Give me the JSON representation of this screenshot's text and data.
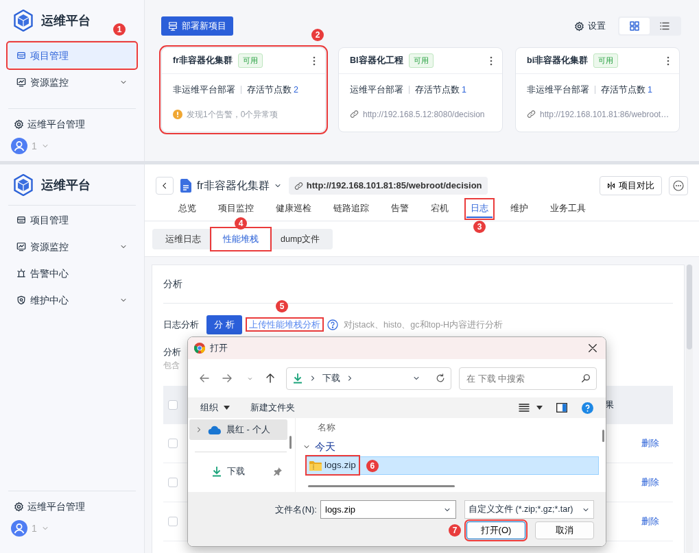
{
  "top_screen": {
    "sidebar": {
      "brand": "运维平台",
      "items": [
        {
          "label": "项目管理",
          "kind": "list",
          "selected": true,
          "expandable": false,
          "step": "1"
        },
        {
          "label": "资源监控",
          "kind": "chart",
          "selected": false,
          "expandable": true
        }
      ],
      "footer": "运维平台管理",
      "user": "1"
    },
    "deploy_button": "部署新项目",
    "settings": "设置",
    "view_toggle": [
      {
        "kind": "grid",
        "selected": true
      },
      {
        "kind": "list",
        "selected": false
      }
    ],
    "cards": [
      {
        "title": "fr非容器化集群",
        "status": "可用",
        "deploy": "非运维平台部署",
        "nodes_label": "存活节点数",
        "nodes": "2",
        "footer": {
          "kind": "warning",
          "text": "发现1个告警，0个异常项"
        },
        "step": "2"
      },
      {
        "title": "BI容器化工程",
        "status": "可用",
        "deploy": "运维平台部署",
        "nodes_label": "存活节点数",
        "nodes": "1",
        "footer": {
          "kind": "link",
          "text": "http://192.168.5.12:8080/decision"
        }
      },
      {
        "title": "bi非容器化集群",
        "status": "可用",
        "deploy": "非运维平台部署",
        "nodes_label": "存活节点数",
        "nodes": "1",
        "footer": {
          "kind": "link",
          "text": "http://192.168.101.81:86/webroot…"
        }
      }
    ]
  },
  "bottom_screen": {
    "sidebar": {
      "brand": "运维平台",
      "items": [
        {
          "label": "项目管理",
          "kind": "list",
          "selected": false,
          "expandable": false
        },
        {
          "label": "资源监控",
          "kind": "chart",
          "selected": false,
          "expandable": true
        },
        {
          "label": "告警中心",
          "kind": "alarm",
          "selected": false,
          "expandable": false
        },
        {
          "label": "维护中心",
          "kind": "shield",
          "selected": false,
          "expandable": true
        }
      ],
      "footer": "运维平台管理",
      "user": "1"
    },
    "project_header": {
      "title": "fr非容器化集群",
      "url": "http://192.168.101.81:85/webroot/decision",
      "compare_button": "项目对比"
    },
    "tabs": [
      {
        "label": "总览",
        "selected": false
      },
      {
        "label": "项目监控",
        "selected": false
      },
      {
        "label": "健康巡检",
        "selected": false
      },
      {
        "label": "链路追踪",
        "selected": false
      },
      {
        "label": "告警",
        "selected": false
      },
      {
        "label": "宕机",
        "selected": false
      },
      {
        "label": "日志",
        "selected": true,
        "step": "3"
      },
      {
        "label": "维护",
        "selected": false
      },
      {
        "label": "业务工具",
        "selected": false
      }
    ],
    "subtabs": [
      {
        "label": "运维日志",
        "selected": false
      },
      {
        "label": "性能堆栈",
        "selected": true,
        "step": "4"
      },
      {
        "label": "dump文件",
        "selected": false
      }
    ],
    "analysis": {
      "heading": "分析",
      "row_label": "日志分析",
      "analyze_button": "分 析",
      "upload_link": {
        "text": "上传性能堆栈分析",
        "step": "5"
      },
      "hint": "对jstack、histo、gc和top-H内容进行分析",
      "records_title": "分析",
      "records_note": "包含",
      "table": {
        "header_checked": false,
        "column_header": "果",
        "rows": [
          {
            "checked": false,
            "action": "删除"
          },
          {
            "checked": false,
            "action": "删除"
          },
          {
            "checked": false,
            "action": "删除"
          }
        ]
      }
    },
    "file_dialog": {
      "title": "打开",
      "path": [
        "下载"
      ],
      "search_placeholder": "在 下载 中搜索",
      "toolbar": {
        "organize": "组织",
        "new_folder": "新建文件夹"
      },
      "nav_items": [
        {
          "kind": "cloud",
          "label": "晨红 - 个人",
          "selected": true,
          "pinned": false
        },
        {
          "kind": "download",
          "label": "下载",
          "selected": false,
          "pinned": true
        }
      ],
      "column": "名称",
      "groups": [
        {
          "label": "今天",
          "expanded": true,
          "files": [
            {
              "name": "logs.zip",
              "selected": true,
              "step": "6"
            }
          ]
        }
      ],
      "file_name_label": "文件名(N):",
      "file_name": "logs.zip",
      "file_type": "自定义文件 (*.zip;*.gz;*.tar)",
      "buttons": [
        {
          "label": "打开(O)",
          "kind": "primary",
          "step": "7"
        },
        {
          "label": "取消",
          "kind": "default"
        }
      ]
    }
  }
}
